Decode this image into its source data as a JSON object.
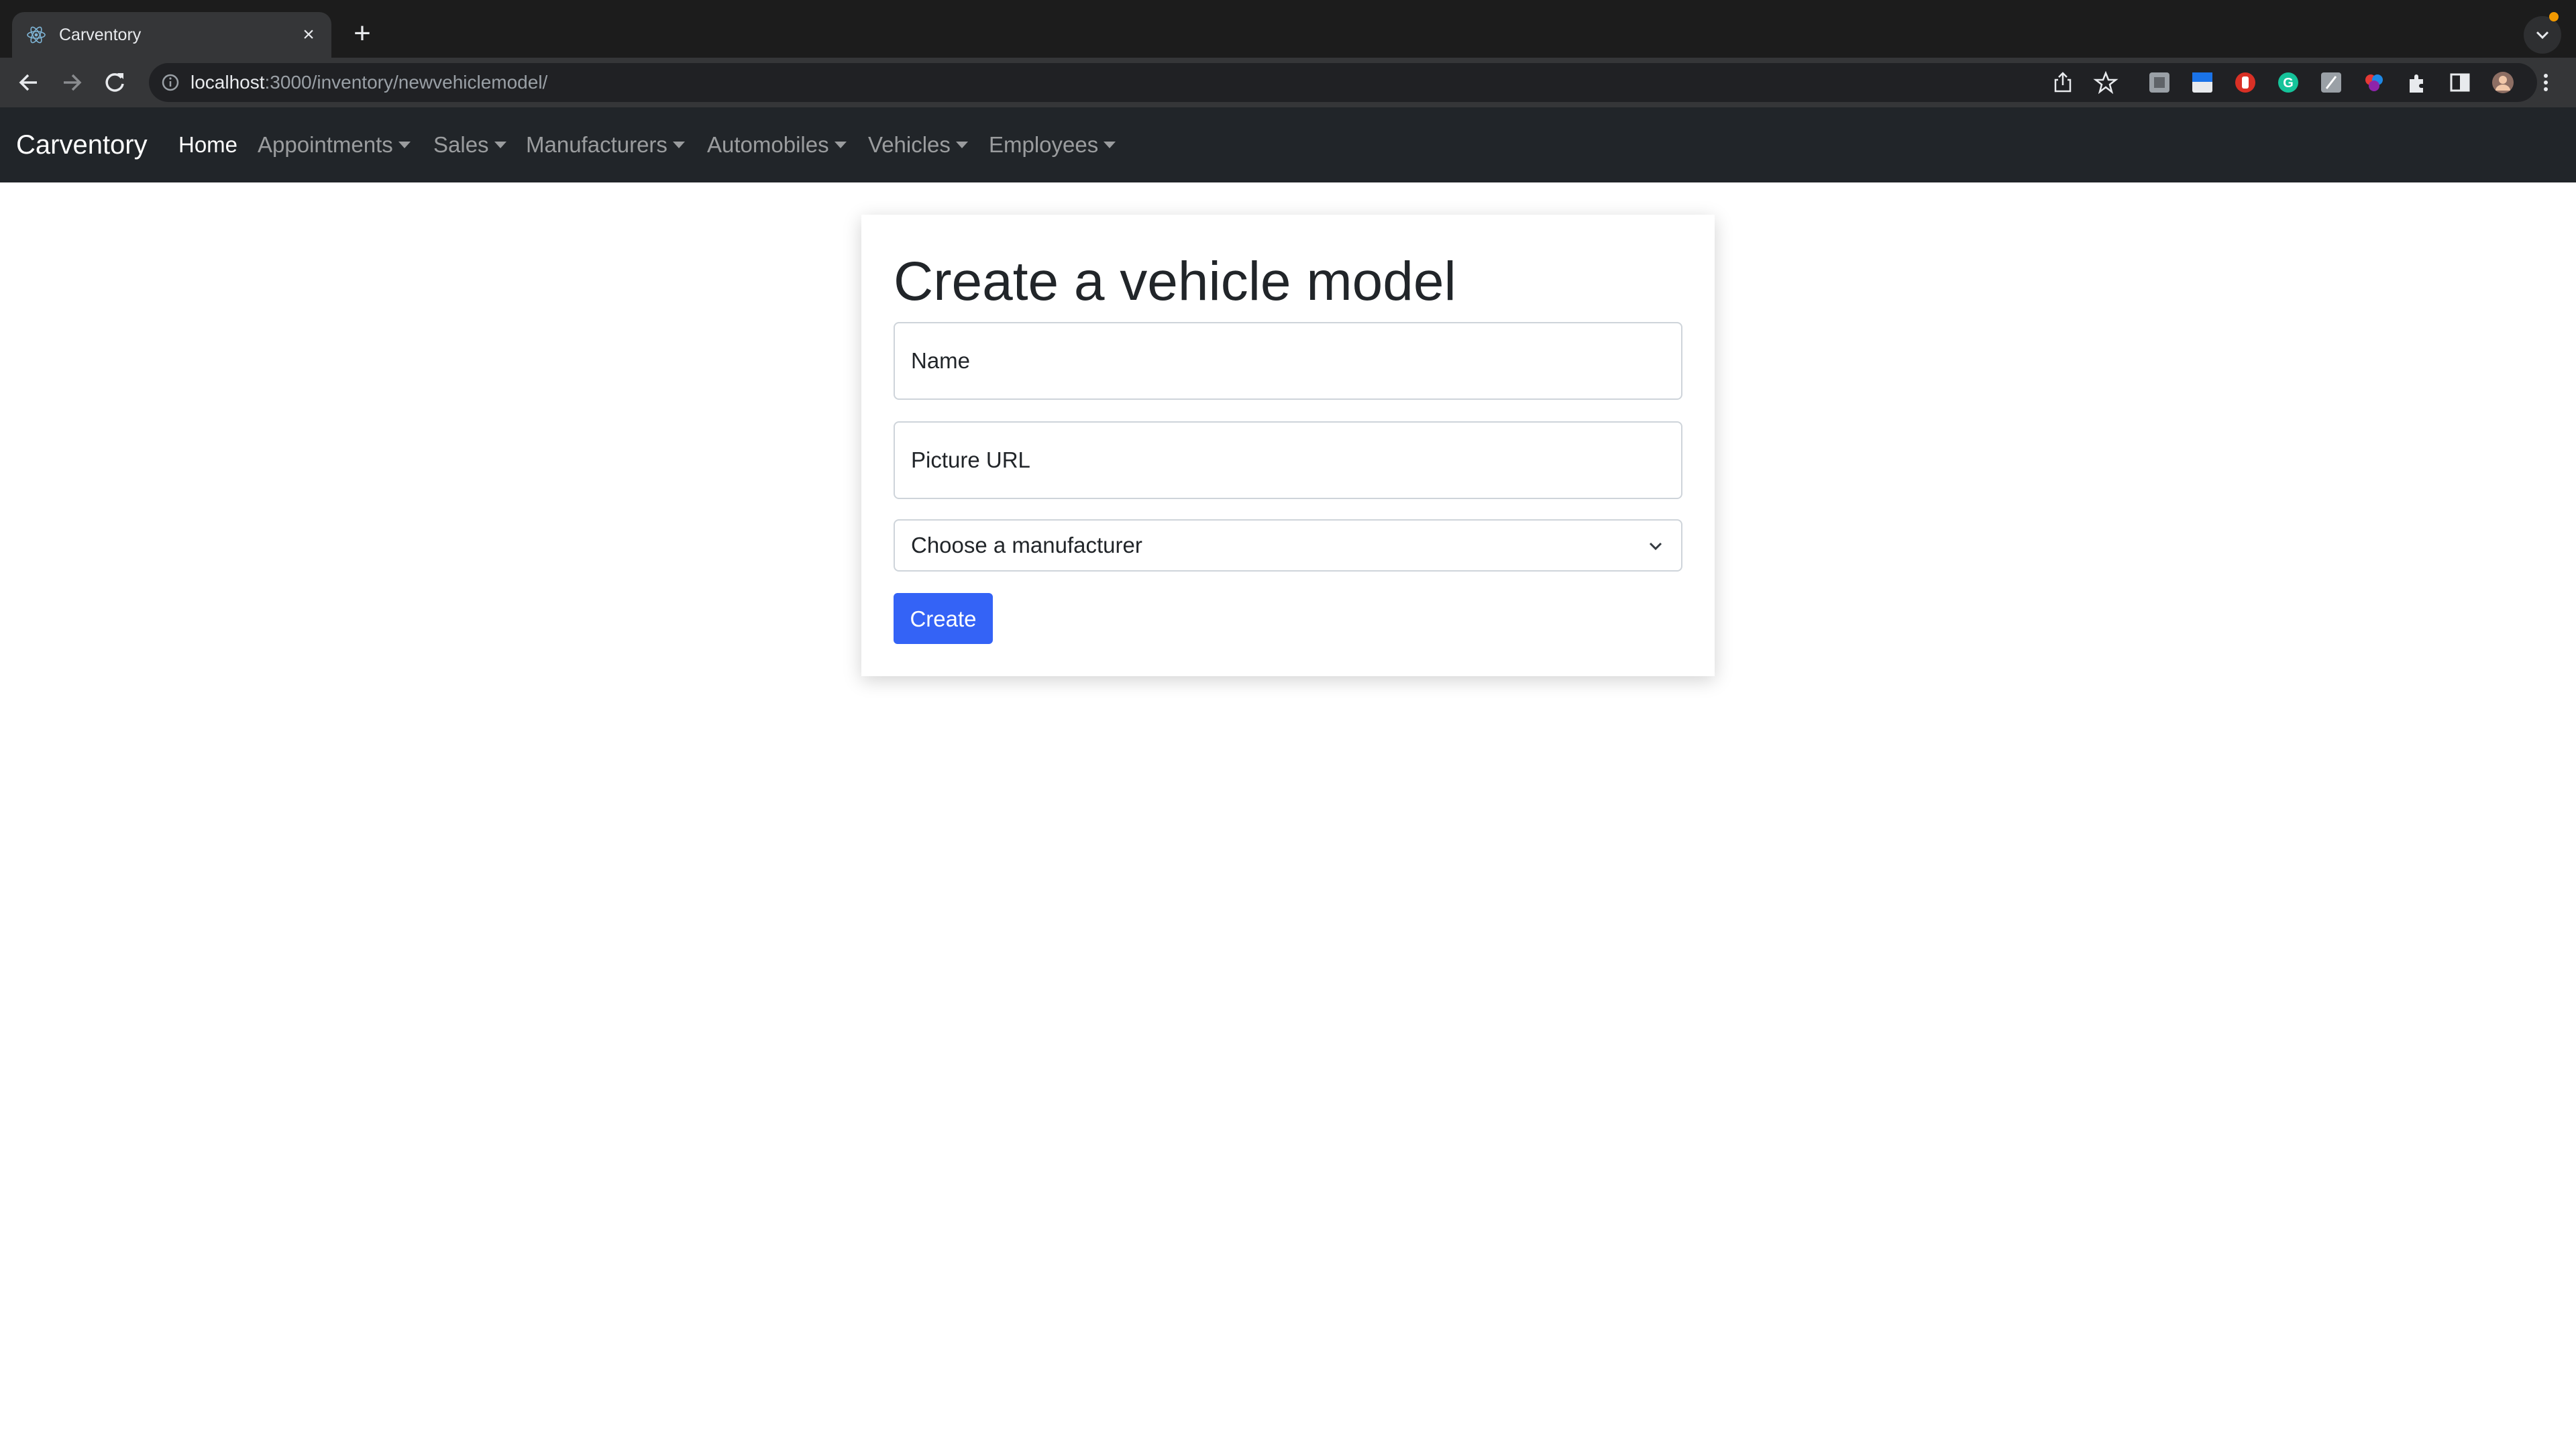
{
  "browser": {
    "tab_title": "Carventory",
    "url_host": "localhost",
    "url_path": ":3000/inventory/newvehiclemodel/"
  },
  "navbar": {
    "brand": "Carventory",
    "links": [
      {
        "label": "Home",
        "active": true,
        "dropdown": false
      },
      {
        "label": "Appointments",
        "active": false,
        "dropdown": true
      },
      {
        "label": "Sales",
        "active": false,
        "dropdown": true
      },
      {
        "label": "Manufacturers",
        "active": false,
        "dropdown": true
      },
      {
        "label": "Automobiles",
        "active": false,
        "dropdown": true
      },
      {
        "label": "Vehicles",
        "active": false,
        "dropdown": true
      },
      {
        "label": "Employees",
        "active": false,
        "dropdown": true
      }
    ]
  },
  "form": {
    "title": "Create a vehicle model",
    "name_placeholder": "Name",
    "picture_placeholder": "Picture URL",
    "manufacturer_select": "Choose a manufacturer",
    "submit_label": "Create"
  },
  "colors": {
    "navbar_bg": "#212529",
    "button_bg": "#3463f6",
    "browser_bg": "#1c1c1c"
  }
}
